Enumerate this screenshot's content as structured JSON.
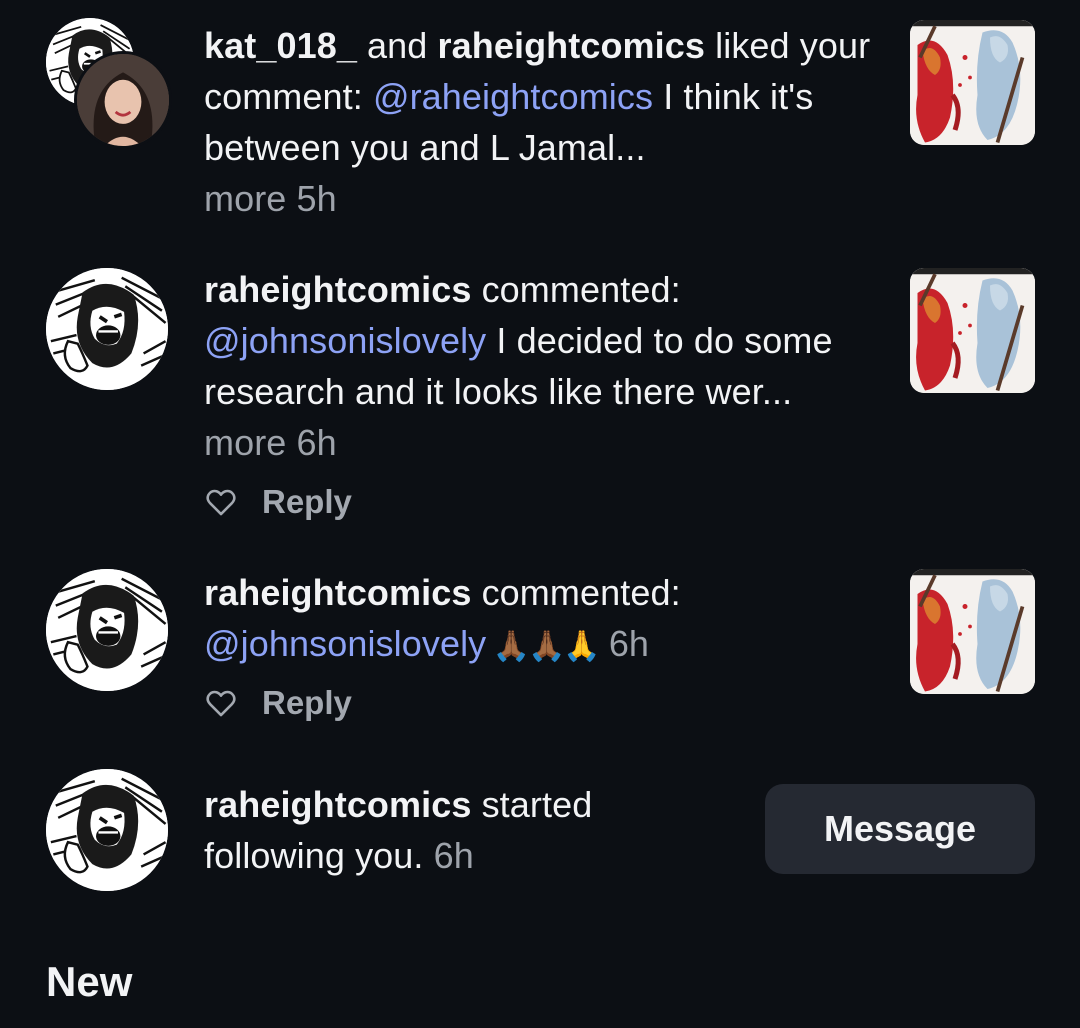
{
  "notifications": [
    {
      "users": [
        "kat_018_",
        "raheightcomics"
      ],
      "joiner": " and ",
      "action": " liked your comment: ",
      "mention": "@raheightcomics",
      "body": " I think it's between you and L Jamal...",
      "more": "more",
      "time": "5h"
    },
    {
      "user": "raheightcomics",
      "action": " commented: ",
      "mention": "@johnsonislovely",
      "body": " I decided to do some research and it looks like there wer...",
      "more": "more",
      "time": "6h",
      "reply_label": "Reply"
    },
    {
      "user": "raheightcomics",
      "action": " commented: ",
      "mention": "@johnsonislovely",
      "body": " 🙏🏾🙏🏾🙏",
      "time": "6h",
      "reply_label": "Reply"
    },
    {
      "user": "raheightcomics",
      "action": " started following you.",
      "time": "6h",
      "button_label": "Message"
    }
  ],
  "section_title": "New",
  "icons": {
    "like": "heart-outline-icon",
    "mention": "threads-at-icon"
  },
  "colors": {
    "background": "#0c0f14",
    "mention": "#8da2f5",
    "muted": "#9ea3ab",
    "button_bg": "#252932"
  }
}
